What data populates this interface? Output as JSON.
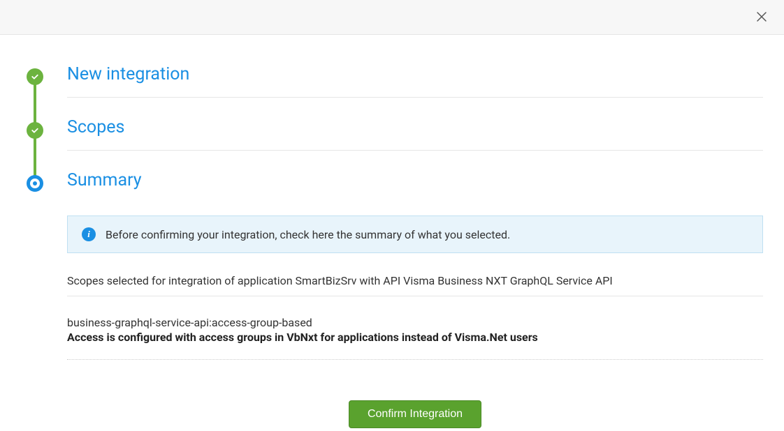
{
  "steps": {
    "new_integration": {
      "label": "New integration"
    },
    "scopes": {
      "label": "Scopes"
    },
    "summary": {
      "label": "Summary"
    }
  },
  "info": {
    "message": "Before confirming your integration, check here the summary of what you selected."
  },
  "summary": {
    "scopes_selected_text": "Scopes selected for integration of application SmartBizSrv with API Visma Business NXT GraphQL Service API",
    "scope_items": [
      {
        "name": "business-graphql-service-api:access-group-based",
        "description": "Access is configured with access groups in VbNxt for applications instead of Visma.Net users"
      }
    ]
  },
  "buttons": {
    "confirm": "Confirm Integration"
  }
}
